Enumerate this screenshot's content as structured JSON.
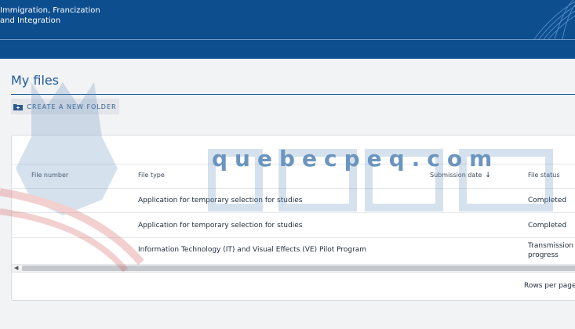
{
  "header": {
    "ministry_line1": "Immigration, Francization",
    "ministry_line2": "and Integration"
  },
  "page": {
    "title": "My files"
  },
  "toolbar": {
    "create_folder_label": "CREATE A NEW FOLDER",
    "create_folder_icon": "folder-plus-icon"
  },
  "table": {
    "columns": [
      "File number",
      "File type",
      "Submission date",
      "File status"
    ],
    "sorted_column": "Submission date",
    "sort_direction": "descending",
    "rows": [
      {
        "file_number": "",
        "file_type": "Application for temporary selection for studies",
        "submission_date": "",
        "file_status": "Completed"
      },
      {
        "file_number": "",
        "file_type": "Application for temporary selection for studies",
        "submission_date": "",
        "file_status": "Completed"
      },
      {
        "file_number": "",
        "file_type": "Information Technology (IT) and Visual Effects (VE) Pilot Program",
        "submission_date": "",
        "file_status_line1": "Transmission",
        "file_status_line2": "progress"
      }
    ]
  },
  "pagination": {
    "rows_per_page_label": "Rows per page"
  },
  "watermark": {
    "text": "quebecpeq.com"
  },
  "colors": {
    "header_bg": "#0d4e8f",
    "title": "#1b5a98",
    "button_bg": "#e3e5ea",
    "page_bg": "#f2f3f5"
  }
}
